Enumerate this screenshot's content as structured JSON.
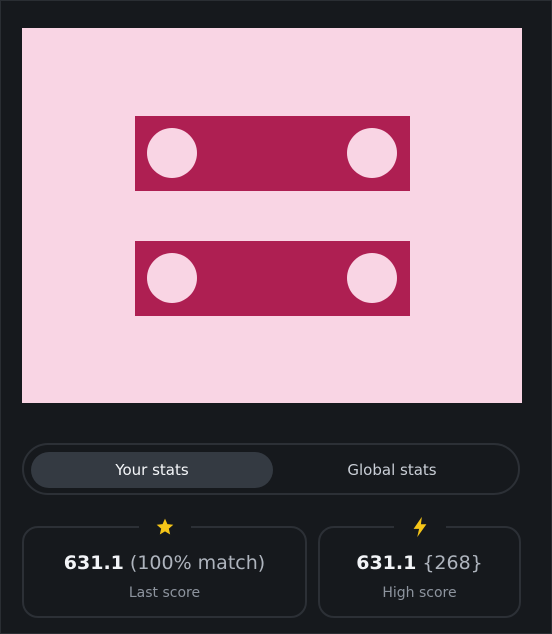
{
  "preview": {
    "background_color": "#f9d5e4",
    "shape_color": "#ae1f52"
  },
  "stats_toggle": {
    "your_stats_label": "Your stats",
    "global_stats_label": "Global stats",
    "selected": "Your stats"
  },
  "last_score_card": {
    "icon": "star-icon",
    "icon_color": "#f5c518",
    "score": "631.1",
    "detail": "(100% match)",
    "label": "Last score"
  },
  "high_score_card": {
    "icon": "lightning-icon",
    "icon_color": "#f5c518",
    "score": "631.1",
    "detail": "{268}",
    "label": "High score"
  }
}
